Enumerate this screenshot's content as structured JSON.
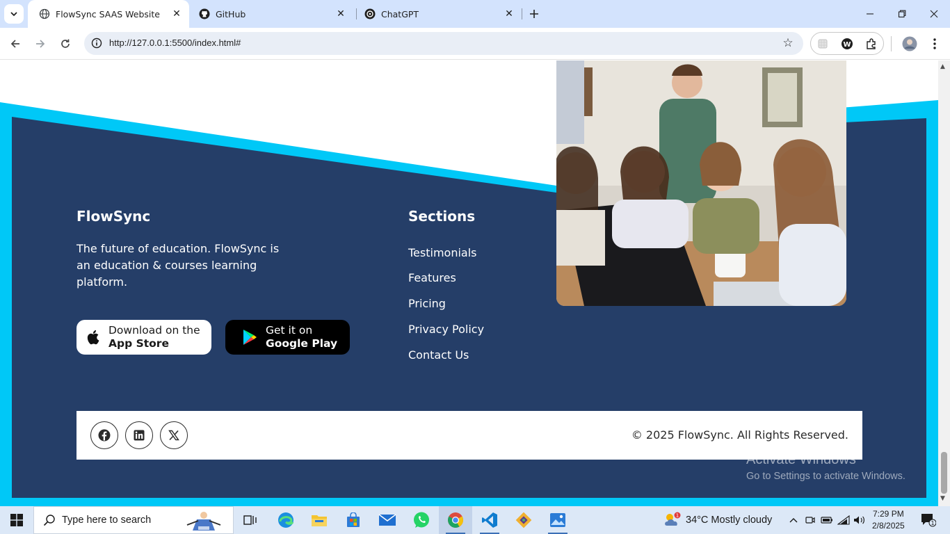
{
  "browser": {
    "tabs": [
      {
        "title": "FlowSync SAAS Website",
        "active": true,
        "icon": "globe-icon"
      },
      {
        "title": "GitHub",
        "active": false,
        "icon": "github-icon"
      },
      {
        "title": "ChatGPT",
        "active": false,
        "icon": "chatgpt-icon"
      }
    ],
    "url": "http://127.0.0.1:5500/index.html#"
  },
  "footer": {
    "brand": "FlowSync",
    "description": "The future of education. FlowSync is an education & courses learning platform.",
    "app_store": {
      "small": "Download on the",
      "big": "App Store"
    },
    "google_play": {
      "small": "Get it on",
      "big": "Google Play"
    },
    "sections_title": "Sections",
    "sections": [
      "Testimonials",
      "Features",
      "Pricing",
      "Privacy Policy",
      "Contact Us"
    ],
    "social": [
      "facebook-icon",
      "linkedin-icon",
      "x-icon"
    ],
    "copyright": "© 2025 FlowSync. All Rights Reserved."
  },
  "watermark": {
    "line1": "Activate Windows",
    "line2": "Go to Settings to activate Windows."
  },
  "taskbar": {
    "search_placeholder": "Type here to search",
    "weather": "34°C  Mostly cloudy",
    "weather_badge": "1",
    "time": "7:29 PM",
    "date": "2/8/2025",
    "notification_count": "1"
  },
  "colors": {
    "footer_navy": "#253e68",
    "accent_cyan": "#00c8f7",
    "tab_strip": "#d3e3fd"
  }
}
